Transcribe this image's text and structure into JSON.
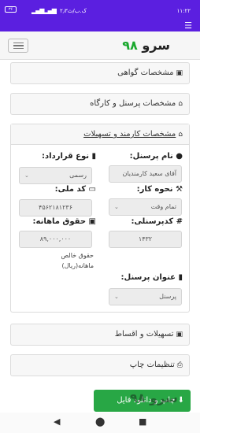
{
  "status": {
    "time": "۱۱:۲۲",
    "network": "۲٫۳ک.ب/ث",
    "signal": "▂▄▆▂▄▆",
    "battery": "۳۶"
  },
  "brand": {
    "name": "سرو",
    "number": "۹۸"
  },
  "sections": [
    {
      "label": "مشخصات گواهی",
      "icon": "book-icon"
    },
    {
      "label": "مشخصات پرسنل و کارگاه",
      "icon": "home-icon"
    },
    {
      "label": "مشخصات کارمند و تسهیلات",
      "icon": "bank-icon"
    },
    {
      "label": "تسهیلات و اقساط",
      "icon": "money-icon"
    },
    {
      "label": "تنظیمات چاپ",
      "icon": "print-icon"
    }
  ],
  "form": {
    "name_label": "نام پرسنل:",
    "name_value": "آقای سعید کارمندیان",
    "contract_label": "نوع قرارداد:",
    "contract_value": "رسمی",
    "work_label": "نحوه کار:",
    "work_value": "تمام وقت",
    "national_label": "کد ملی:",
    "national_value": "۴۵۶۲۱۸۱۲۳۶",
    "code_label": "کدپرسنلی:",
    "code_value": "۱۴۳۲",
    "salary_label": "حقوق ماهانه:",
    "salary_value": "۸۹,۰۰۰,۰۰۰",
    "salary_note": "حقوق خالص ماهانه(ریال)",
    "title_label": "عنوان پرسنل:",
    "title_value": "پرسنل"
  },
  "download_label": "چاپ و دانلود فایل",
  "watermark": "سرو ۹۸",
  "nav": {
    "back": "◀",
    "home": "⬤",
    "recents": "■"
  }
}
